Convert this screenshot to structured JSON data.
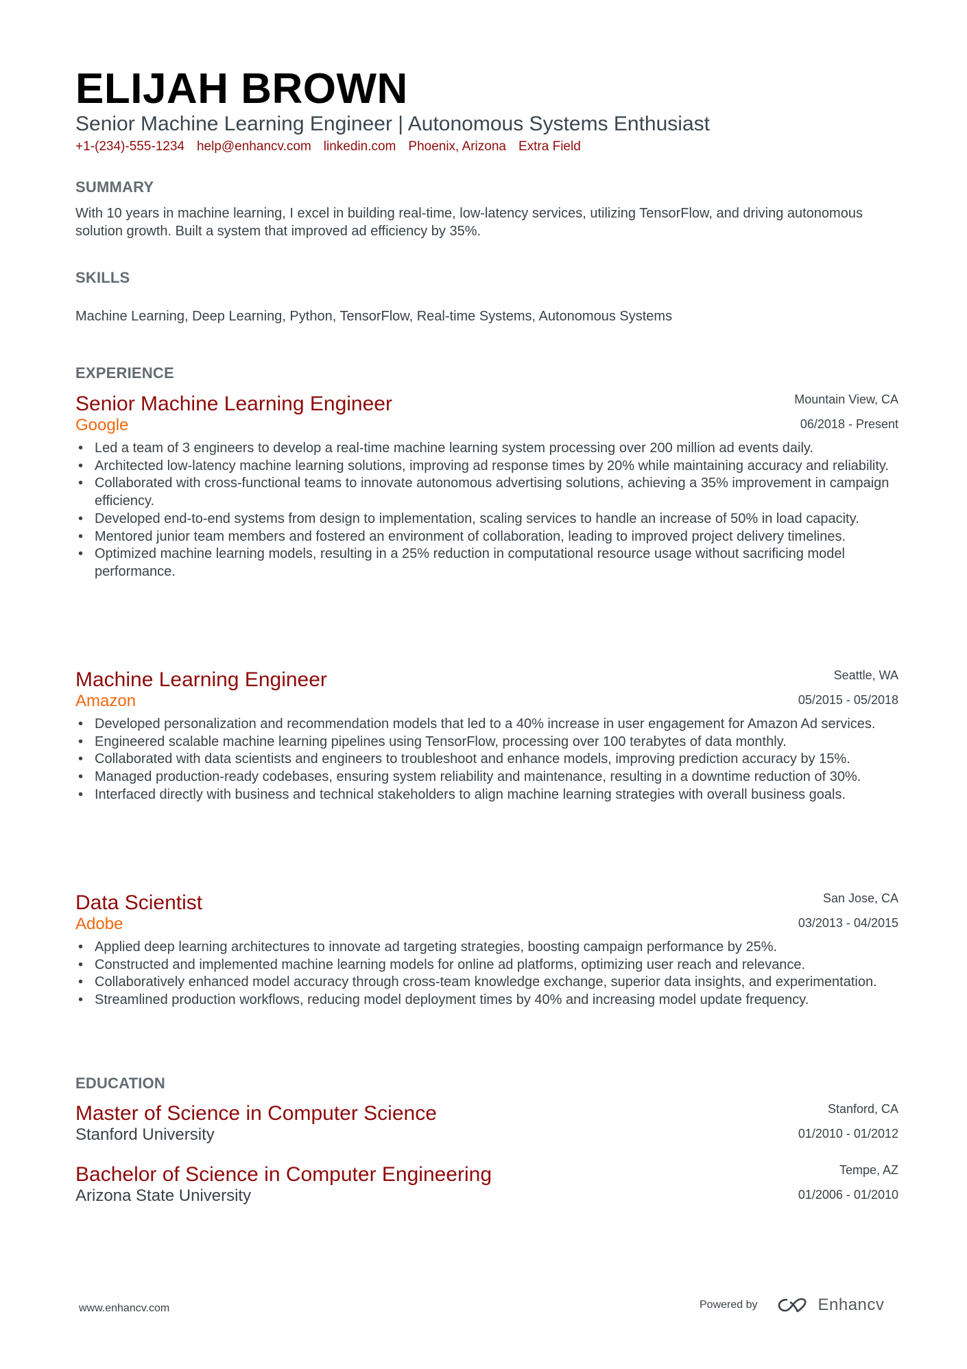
{
  "header": {
    "name": "ELIJAH BROWN",
    "headline": "Senior Machine Learning Engineer | Autonomous Systems Enthusiast",
    "contacts": [
      "+1-(234)-555-1234",
      "help@enhancv.com",
      "linkedin.com",
      "Phoenix, Arizona",
      "Extra Field"
    ]
  },
  "summary": {
    "title": "SUMMARY",
    "text": "With 10 years in machine learning, I excel in building real-time, low-latency services, utilizing TensorFlow, and driving autonomous solution growth. Built a system that improved ad efficiency by 35%."
  },
  "skills": {
    "title": "SKILLS",
    "text": "Machine Learning, Deep Learning, Python, TensorFlow, Real-time Systems, Autonomous Systems"
  },
  "experience": {
    "title": "EXPERIENCE",
    "jobs": [
      {
        "title": "Senior Machine Learning Engineer",
        "company": "Google",
        "location": "Mountain View, CA",
        "dates": "06/2018 - Present",
        "bullets": [
          "Led a team of 3 engineers to develop a real-time machine learning system processing over 200 million ad events daily.",
          "Architected low-latency machine learning solutions, improving ad response times by 20% while maintaining accuracy and reliability.",
          "Collaborated with cross-functional teams to innovate autonomous advertising solutions, achieving a 35% improvement in campaign efficiency.",
          "Developed end-to-end systems from design to implementation, scaling services to handle an increase of 50% in load capacity.",
          "Mentored junior team members and fostered an environment of collaboration, leading to improved project delivery timelines.",
          "Optimized machine learning models, resulting in a 25% reduction in computational resource usage without sacrificing model performance."
        ]
      },
      {
        "title": "Machine Learning Engineer",
        "company": "Amazon",
        "location": "Seattle, WA",
        "dates": "05/2015 - 05/2018",
        "bullets": [
          "Developed personalization and recommendation models that led to a 40% increase in user engagement for Amazon Ad services.",
          "Engineered scalable machine learning pipelines using TensorFlow, processing over 100 terabytes of data monthly.",
          "Collaborated with data scientists and engineers to troubleshoot and enhance models, improving prediction accuracy by 15%.",
          "Managed production-ready codebases, ensuring system reliability and maintenance, resulting in a downtime reduction of 30%.",
          "Interfaced directly with business and technical stakeholders to align machine learning strategies with overall business goals."
        ]
      },
      {
        "title": "Data Scientist",
        "company": "Adobe",
        "location": "San Jose, CA",
        "dates": "03/2013 - 04/2015",
        "bullets": [
          "Applied deep learning architectures to innovate ad targeting strategies, boosting campaign performance by 25%.",
          "Constructed and implemented machine learning models for online ad platforms, optimizing user reach and relevance.",
          "Collaboratively enhanced model accuracy through cross-team knowledge exchange, superior data insights, and experimentation.",
          "Streamlined production workflows, reducing model deployment times by 40% and increasing model update frequency."
        ]
      }
    ]
  },
  "education": {
    "title": "EDUCATION",
    "items": [
      {
        "degree": "Master of Science in Computer Science",
        "school": "Stanford University",
        "location": "Stanford, CA",
        "dates": "01/2010 - 01/2012"
      },
      {
        "degree": "Bachelor of Science in Computer Engineering",
        "school": "Arizona State University",
        "location": "Tempe, AZ",
        "dates": "01/2006 - 01/2010"
      }
    ]
  },
  "footer": {
    "website": "www.enhancv.com",
    "powered_by": "Powered by",
    "brand": "Enhancv",
    "brand_icon": "enhancv-logo-icon"
  },
  "colors": {
    "accent_title": "#8f0a0a",
    "accent_company": "#f0680e",
    "section_heading": "#646b72",
    "text": "#3b4148"
  }
}
